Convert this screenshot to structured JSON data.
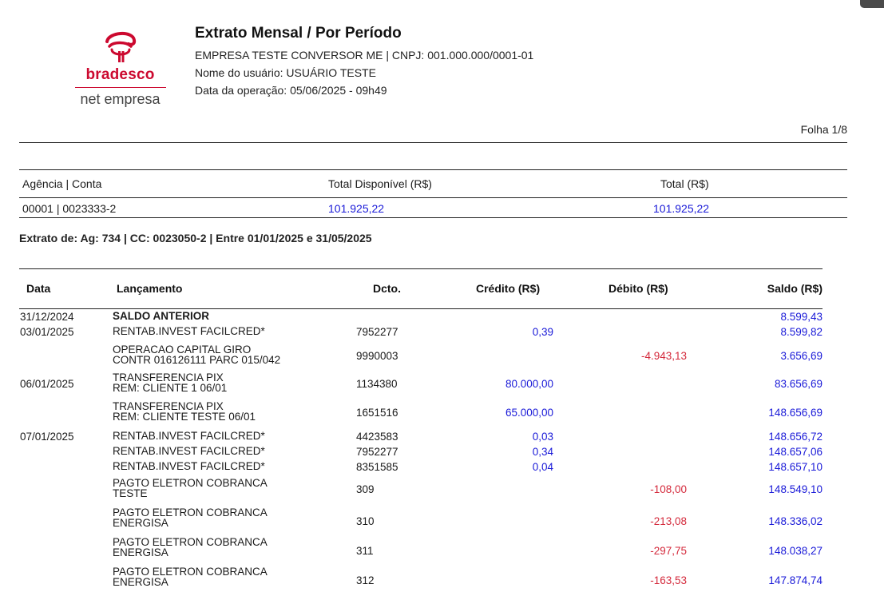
{
  "logo": {
    "brand": "bradesco",
    "sub": "net empresa"
  },
  "header": {
    "title": "Extrato Mensal / Por Período",
    "company": "EMPRESA TESTE CONVERSOR ME  | CNPJ: 001.000.000/0001-01",
    "user": "Nome do usuário: USUÁRIO TESTE",
    "date": "Data da operação: 05/06/2025 - 09h49"
  },
  "page_label": "Folha 1/8",
  "account": {
    "headers": {
      "agency_account": "Agência | Conta",
      "available": "Total Disponível (R$)",
      "total": "Total (R$)"
    },
    "values": {
      "agency_account": "00001 | 0023333-2",
      "available": "101.925,22",
      "total": "101.925,22"
    }
  },
  "period": "Extrato de: Ag: 734 | CC: 0023050-2 | Entre 01/01/2025 e 31/05/2025",
  "table": {
    "headers": {
      "date": "Data",
      "description": "Lançamento",
      "doc": "Dcto.",
      "credit": "Crédito (R$)",
      "debit": "Débito (R$)",
      "balance": "Saldo (R$)"
    },
    "rows": [
      {
        "date": "31/12/2024",
        "description": "SALDO ANTERIOR",
        "doc": "",
        "credit": "",
        "debit": "",
        "balance": "8.599,43"
      },
      {
        "date": "03/01/2025",
        "description": "RENTAB.INVEST FACILCRED*",
        "doc": "7952277",
        "credit": "0,39",
        "debit": "",
        "balance": "8.599,82"
      },
      {
        "date": "",
        "description": "OPERACAO CAPITAL GIRO\nCONTR 016126111 PARC 015/042",
        "doc": "9990003",
        "credit": "",
        "debit": "-4.943,13",
        "balance": "3.656,69"
      },
      {
        "date": "06/01/2025",
        "description": "TRANSFERENCIA PIX\nREM: CLIENTE 1 06/01",
        "doc": "1134380",
        "credit": "80.000,00",
        "debit": "",
        "balance": "83.656,69"
      },
      {
        "date": "",
        "description": "TRANSFERENCIA PIX\nREM: CLIENTE TESTE 06/01",
        "doc": "1651516",
        "credit": "65.000,00",
        "debit": "",
        "balance": "148.656,69"
      },
      {
        "date": "07/01/2025",
        "description": "RENTAB.INVEST FACILCRED*",
        "doc": "4423583",
        "credit": "0,03",
        "debit": "",
        "balance": "148.656,72"
      },
      {
        "date": "",
        "description": "RENTAB.INVEST FACILCRED*",
        "doc": "7952277",
        "credit": "0,34",
        "debit": "",
        "balance": "148.657,06"
      },
      {
        "date": "",
        "description": "RENTAB.INVEST FACILCRED*",
        "doc": "8351585",
        "credit": "0,04",
        "debit": "",
        "balance": "148.657,10"
      },
      {
        "date": "",
        "description": "PAGTO ELETRON COBRANCA\nTESTE",
        "doc": "309",
        "credit": "",
        "debit": "-108,00",
        "balance": "148.549,10"
      },
      {
        "date": "",
        "description": "PAGTO ELETRON COBRANCA\nENERGISA",
        "doc": "310",
        "credit": "",
        "debit": "-213,08",
        "balance": "148.336,02"
      },
      {
        "date": "",
        "description": "PAGTO ELETRON COBRANCA\nENERGISA",
        "doc": "311",
        "credit": "",
        "debit": "-297,75",
        "balance": "148.038,27"
      },
      {
        "date": "",
        "description": "PAGTO ELETRON COBRANCA\nENERGISA",
        "doc": "312",
        "credit": "",
        "debit": "-163,53",
        "balance": "147.874,74"
      }
    ]
  }
}
